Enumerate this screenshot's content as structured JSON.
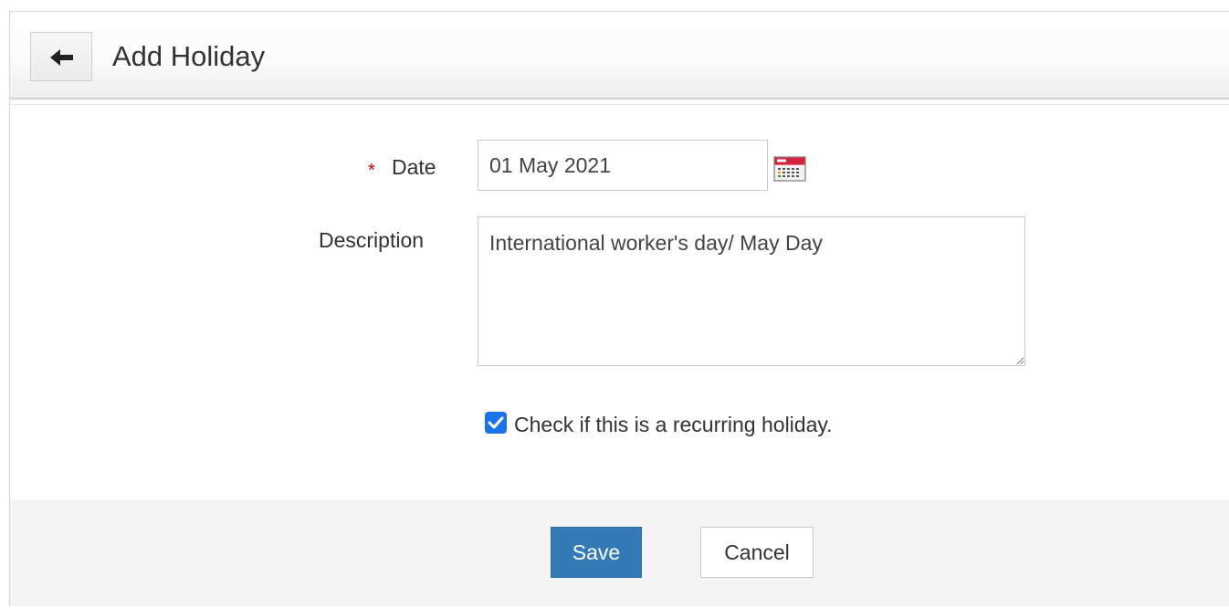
{
  "header": {
    "back_icon": "arrow-left-icon",
    "title": "Add Holiday"
  },
  "form": {
    "date": {
      "label": "Date",
      "required_marker": "*",
      "value": "01 May 2021",
      "icon": "calendar-icon"
    },
    "description": {
      "label": "Description",
      "value": "International worker's day/ May Day"
    },
    "recurring": {
      "label": "Check if this is a recurring holiday.",
      "checked": true
    }
  },
  "footer": {
    "save_label": "Save",
    "cancel_label": "Cancel"
  },
  "colors": {
    "primary_button": "#337ab7",
    "checkbox": "#1a73e8",
    "required": "#cc0000"
  }
}
